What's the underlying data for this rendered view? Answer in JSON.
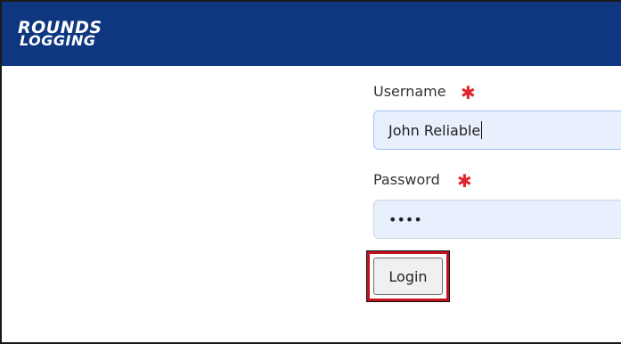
{
  "header": {
    "logo_line1": "ROUNDS",
    "logo_line2": "LOGGING",
    "background_color": "#0f3780"
  },
  "form": {
    "username": {
      "label": "Username",
      "required_marker": "✱",
      "value": "John Reliable"
    },
    "password": {
      "label": "Password",
      "required_marker": "✱",
      "value": "••••"
    },
    "login_button": {
      "label": "Login"
    }
  },
  "colors": {
    "required": "#e0262b",
    "highlight": "#c1121f",
    "input_background": "#e8f0fe"
  }
}
